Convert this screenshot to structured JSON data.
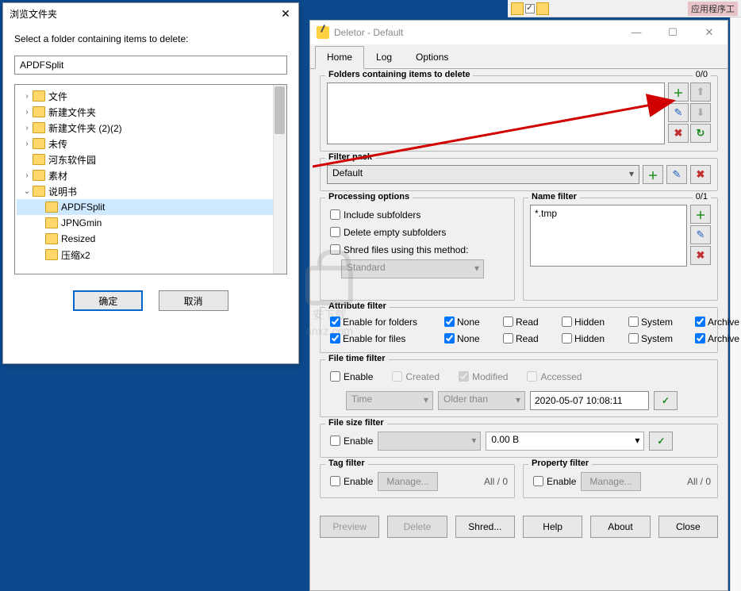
{
  "taskbar": {
    "label": "应用程序工"
  },
  "browse": {
    "title": "浏览文件夹",
    "instruction": "Select a folder containing items to delete:",
    "path_value": "APDFSplit",
    "ok": "确定",
    "cancel": "取消",
    "tree": [
      {
        "label": "文件",
        "indent": 0,
        "exp": "›",
        "sel": false
      },
      {
        "label": "新建文件夹",
        "indent": 0,
        "exp": "›",
        "sel": false
      },
      {
        "label": "新建文件夹 (2)(2)",
        "indent": 0,
        "exp": "›",
        "sel": false
      },
      {
        "label": "未传",
        "indent": 0,
        "exp": "›",
        "sel": false
      },
      {
        "label": "河东软件园",
        "indent": 0,
        "exp": "",
        "sel": false
      },
      {
        "label": "素材",
        "indent": 0,
        "exp": "›",
        "sel": false
      },
      {
        "label": "说明书",
        "indent": 0,
        "exp": "⌄",
        "sel": false
      },
      {
        "label": "APDFSplit",
        "indent": 1,
        "exp": "",
        "sel": true
      },
      {
        "label": "JPNGmin",
        "indent": 1,
        "exp": "",
        "sel": false
      },
      {
        "label": "Resized",
        "indent": 1,
        "exp": "",
        "sel": false
      },
      {
        "label": "压缩x2",
        "indent": 1,
        "exp": "",
        "sel": false
      }
    ]
  },
  "deletor": {
    "title": "Deletor - Default",
    "tabs": {
      "home": "Home",
      "log": "Log",
      "options": "Options"
    },
    "folders": {
      "title": "Folders containing items to delete",
      "count": "0/0"
    },
    "filter_pack": {
      "title": "Filter pack",
      "value": "Default"
    },
    "processing": {
      "title": "Processing options",
      "include_sub": "Include subfolders",
      "delete_empty": "Delete empty subfolders",
      "shred": "Shred files using this method:",
      "shred_method": "Standard"
    },
    "name_filter": {
      "title": "Name filter",
      "count": "0/1",
      "pattern": "*.tmp"
    },
    "attr": {
      "title": "Attribute filter",
      "folders_label": "Enable for folders",
      "files_label": "Enable for files",
      "none": "None",
      "read": "Read",
      "hidden": "Hidden",
      "system": "System",
      "archive": "Archive"
    },
    "time": {
      "title": "File time filter",
      "enable": "Enable",
      "created": "Created",
      "modified": "Modified",
      "accessed": "Accessed",
      "field": "Time",
      "op": "Older than",
      "value": "2020-05-07 10:08:11"
    },
    "size": {
      "title": "File size filter",
      "enable": "Enable",
      "value": "0.00 B"
    },
    "tag": {
      "title": "Tag filter",
      "enable": "Enable",
      "manage": "Manage...",
      "count": "All / 0"
    },
    "prop": {
      "title": "Property filter",
      "enable": "Enable",
      "manage": "Manage...",
      "count": "All / 0"
    },
    "buttons": {
      "preview": "Preview",
      "delete": "Delete",
      "shred": "Shred...",
      "help": "Help",
      "about": "About",
      "close": "Close"
    }
  },
  "watermark": {
    "host": "anxz.com",
    "sub": "安下载"
  }
}
